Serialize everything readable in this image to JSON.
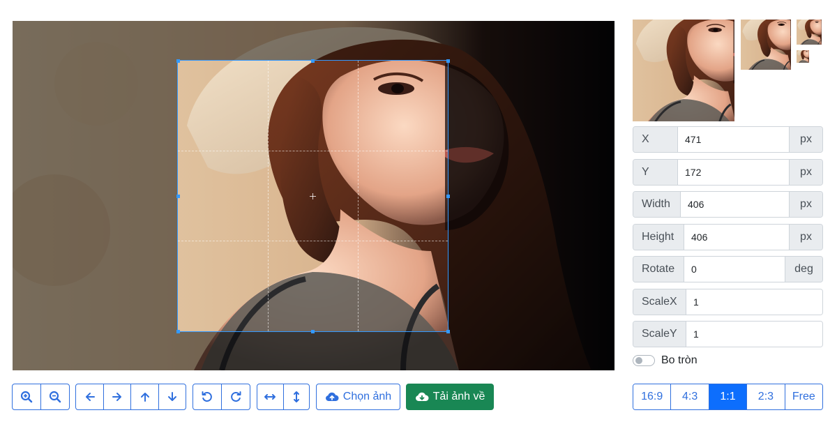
{
  "fields": [
    {
      "label": "X",
      "value": "471",
      "unit": "px"
    },
    {
      "label": "Y",
      "value": "172",
      "unit": "px"
    },
    {
      "label": "Width",
      "value": "406",
      "unit": "px"
    },
    {
      "label": "Height",
      "value": "406",
      "unit": "px"
    },
    {
      "label": "Rotate",
      "value": "0",
      "unit": "deg"
    },
    {
      "label": "ScaleX",
      "value": "1"
    },
    {
      "label": "ScaleY",
      "value": "1"
    }
  ],
  "round_toggle": {
    "label": "Bo tròn",
    "on": false
  },
  "toolbar": {
    "choose_label": "Chọn ảnh",
    "download_label": "Tải ảnh về"
  },
  "ratios": [
    "16:9",
    "4:3",
    "1:1",
    "2:3",
    "Free"
  ],
  "active_ratio": "1:1",
  "colors": {
    "primary": "#2f6fde",
    "active": "#0d6efd",
    "success": "#198754",
    "crop_outline": "#3399ff"
  }
}
